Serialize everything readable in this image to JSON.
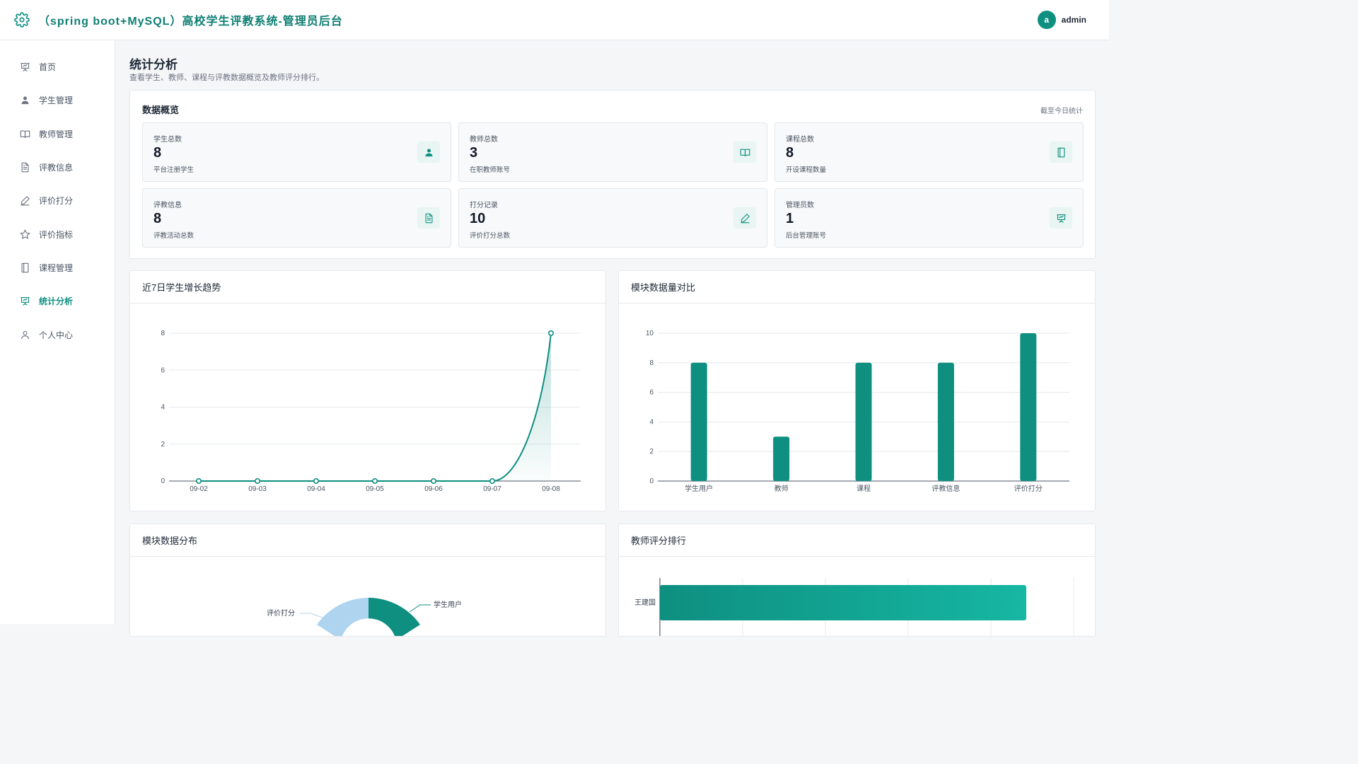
{
  "header": {
    "title": "（spring boot+MySQL）高校学生评教系统-管理员后台",
    "avatar_letter": "a",
    "user_name": "admin"
  },
  "sidebar": {
    "items": [
      {
        "label": "首页",
        "icon": "presentation-icon"
      },
      {
        "label": "学生管理",
        "icon": "user-filled-icon"
      },
      {
        "label": "教师管理",
        "icon": "book-open-icon"
      },
      {
        "label": "评教信息",
        "icon": "document-icon"
      },
      {
        "label": "评价打分",
        "icon": "pen-icon"
      },
      {
        "label": "评价指标",
        "icon": "star-icon"
      },
      {
        "label": "课程管理",
        "icon": "notebook-icon"
      },
      {
        "label": "统计分析",
        "icon": "presentation-icon",
        "active": true
      },
      {
        "label": "个人中心",
        "icon": "user-outline-icon"
      }
    ]
  },
  "page": {
    "title": "统计分析",
    "subtitle": "查看学生、教师、课程与评教数据概览及教师评分排行。"
  },
  "overview": {
    "title": "数据概览",
    "note": "截至今日统计",
    "stats": [
      {
        "label": "学生总数",
        "value": "8",
        "desc": "平台注册学生",
        "icon": "user-icon"
      },
      {
        "label": "教师总数",
        "value": "3",
        "desc": "在职教师账号",
        "icon": "book-open-icon"
      },
      {
        "label": "课程总数",
        "value": "8",
        "desc": "开设课程数量",
        "icon": "notebook-icon"
      },
      {
        "label": "评教信息",
        "value": "8",
        "desc": "评教活动总数",
        "icon": "document-icon"
      },
      {
        "label": "打分记录",
        "value": "10",
        "desc": "评价打分总数",
        "icon": "pen-icon"
      },
      {
        "label": "管理员数",
        "value": "1",
        "desc": "后台管理账号",
        "icon": "presentation-icon"
      }
    ]
  },
  "colors": {
    "accent": "#0e8f80",
    "pie_light": "#aed4f0"
  },
  "chart_data": [
    {
      "type": "line",
      "title": "近7日学生增长趋势",
      "x": [
        "09-02",
        "09-03",
        "09-04",
        "09-05",
        "09-06",
        "09-07",
        "09-08"
      ],
      "values": [
        0,
        0,
        0,
        0,
        0,
        0,
        8
      ],
      "ylim": [
        0,
        8
      ],
      "yticks": [
        0,
        2,
        4,
        6,
        8
      ],
      "grid": true
    },
    {
      "type": "bar",
      "title": "模块数据量对比",
      "categories": [
        "学生用户",
        "教师",
        "课程",
        "评教信息",
        "评价打分"
      ],
      "values": [
        8,
        3,
        8,
        8,
        10
      ],
      "ylim": [
        0,
        10
      ],
      "yticks": [
        0,
        2,
        4,
        6,
        8,
        10
      ],
      "grid": true
    },
    {
      "type": "pie",
      "title": "模块数据分布",
      "labels": [
        "学生用户",
        "评价打分"
      ],
      "visible_only": true
    },
    {
      "type": "bar",
      "orientation": "horizontal",
      "title": "教师评分排行",
      "categories": [
        "王建国"
      ],
      "visible_only": true
    }
  ]
}
